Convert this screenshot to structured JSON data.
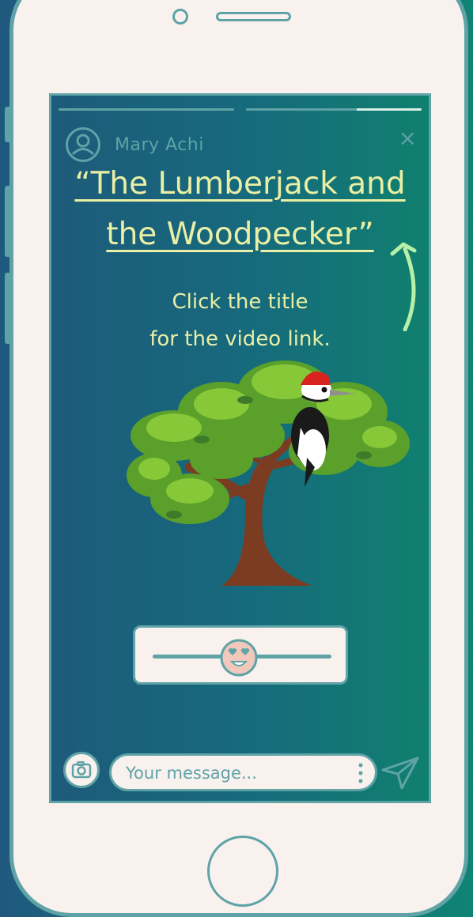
{
  "story": {
    "user_name": "Mary Achi",
    "close_label": "×",
    "title_line1": "“The Lumberjack and",
    "title_line2": "the Woodpecker”",
    "instruction_line1": "Click the title",
    "instruction_line2": "for the video link.",
    "progress": [
      1,
      0.37
    ]
  },
  "reaction": {
    "emoji": "heart-eyes-emoji",
    "slider_value": 0.47
  },
  "composer": {
    "placeholder": "Your message..."
  },
  "icons": {
    "camera": "camera-icon",
    "send": "send-icon",
    "more": "more-vertical-icon",
    "avatar": "user-circle-icon",
    "arrow": "curved-arrow-icon"
  },
  "colors": {
    "frame": "#5fa3a6",
    "phone_body": "#f8f1ee",
    "screen_dark": "#1d5b7a",
    "screen_light": "#10806f",
    "title_text": "#e9efa5",
    "arrow": "#b9f0a8"
  }
}
